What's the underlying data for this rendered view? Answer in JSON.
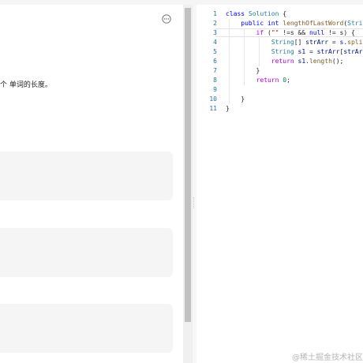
{
  "problem": {
    "description": "个 单词的长度。",
    "more_icon": "more-horizontal-icon"
  },
  "editor": {
    "language": "java",
    "lines": [
      {
        "n": "1",
        "tokens": [
          [
            "kw",
            "class"
          ],
          [
            "",
            ""
          ],
          [
            "ty",
            " Solution"
          ],
          [
            "",
            " {"
          ]
        ]
      },
      {
        "n": "2",
        "tokens": [
          [
            "",
            "    "
          ],
          [
            "kw",
            "public"
          ],
          [
            "",
            ""
          ],
          [
            "kw",
            " int"
          ],
          [
            "fn",
            " lengthOfLastWord"
          ],
          [
            "",
            "("
          ],
          [
            "ty",
            "Strin"
          ]
        ]
      },
      {
        "n": "3",
        "tokens": [
          [
            "",
            "        "
          ],
          [
            "ctl",
            "if"
          ],
          [
            "",
            " ("
          ],
          [
            "str",
            "\"\""
          ],
          [
            "",
            ""
          ],
          [
            "",
            " !=s && "
          ],
          [
            "kw",
            "null"
          ],
          [
            "",
            " != s) {"
          ]
        ]
      },
      {
        "n": "4",
        "tokens": [
          [
            "",
            "            "
          ],
          [
            "ty",
            "String"
          ],
          [
            "",
            "[] "
          ],
          [
            "vr",
            "strArr"
          ],
          [
            "",
            " = "
          ],
          [
            "vr",
            "s"
          ],
          [
            "",
            "."
          ],
          [
            "fn",
            "split"
          ]
        ]
      },
      {
        "n": "5",
        "tokens": [
          [
            "",
            "            "
          ],
          [
            "ty",
            "String"
          ],
          [
            "vr",
            " s1"
          ],
          [
            "",
            " = "
          ],
          [
            "vr",
            "strArr"
          ],
          [
            "",
            "["
          ],
          [
            "vr",
            "strArr"
          ]
        ]
      },
      {
        "n": "6",
        "tokens": [
          [
            "",
            "            "
          ],
          [
            "ctl",
            "return"
          ],
          [
            "vr",
            " s1"
          ],
          [
            "",
            "."
          ],
          [
            "fn",
            "length"
          ],
          [
            "",
            "();"
          ]
        ]
      },
      {
        "n": "7",
        "tokens": [
          [
            "",
            "        }"
          ]
        ]
      },
      {
        "n": "8",
        "tokens": [
          [
            "",
            "        "
          ],
          [
            "ctl",
            "return"
          ],
          [
            "num",
            " 0"
          ],
          [
            "",
            ";"
          ]
        ]
      },
      {
        "n": "9",
        "tokens": [
          [
            "",
            ""
          ]
        ]
      },
      {
        "n": "10",
        "tokens": [
          [
            "",
            "    }"
          ]
        ]
      },
      {
        "n": "11",
        "tokens": [
          [
            "",
            "}"
          ]
        ]
      }
    ]
  },
  "watermark": "@稀土掘金技术社区"
}
